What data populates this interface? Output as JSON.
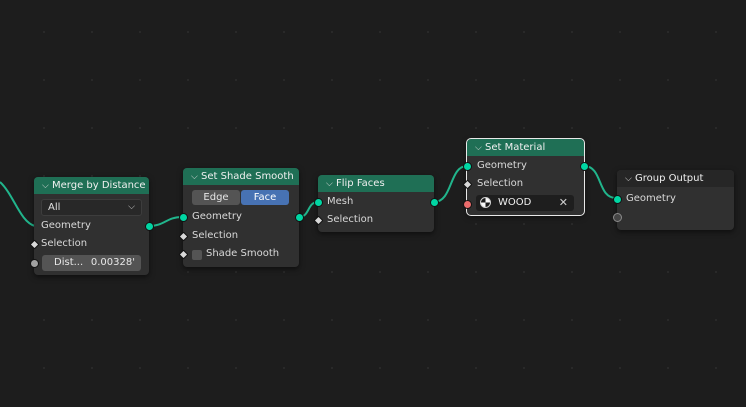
{
  "colors": {
    "background": "#1d1d1d",
    "node_body": "#303030",
    "geometry_header": "#1f6f55",
    "output_header": "#262626",
    "geometry_socket": "#00d6a3",
    "material_socket": "#ea6b6b",
    "selected_outline": "#e8e8e8",
    "active_toggle": "#4772b3"
  },
  "nodes": {
    "merge": {
      "title": "Merge by Distance",
      "mode": "All",
      "geometry": "Geometry",
      "selection": "Selection",
      "distance_label": "Dist...",
      "distance_value": "0.00328'"
    },
    "shade": {
      "title": "Set Shade Smooth",
      "edge": "Edge",
      "face": "Face",
      "geometry": "Geometry",
      "selection": "Selection",
      "shade_smooth": "Shade Smooth"
    },
    "flip": {
      "title": "Flip Faces",
      "mesh": "Mesh",
      "selection": "Selection"
    },
    "material": {
      "title": "Set Material",
      "geometry": "Geometry",
      "selection": "Selection",
      "material_name": "WOOD"
    },
    "output": {
      "title": "Group Output",
      "geometry": "Geometry"
    }
  }
}
